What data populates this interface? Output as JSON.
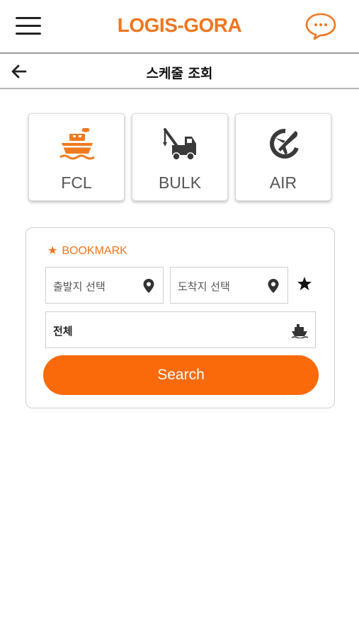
{
  "header": {
    "brand": "LOGIS-GORA",
    "menu_icon": "hamburger-menu-icon",
    "chat_icon": "chat-bubble-icon"
  },
  "subheader": {
    "title": "스케줄 조회",
    "back_icon": "arrow-left-icon"
  },
  "modes": [
    {
      "label": "FCL",
      "icon": "container-ship-icon"
    },
    {
      "label": "BULK",
      "icon": "crane-truck-icon"
    },
    {
      "label": "AIR",
      "icon": "airplane-icon"
    }
  ],
  "panel": {
    "bookmark_label": "BOOKMARK",
    "origin_placeholder": "출발지 선택",
    "destination_placeholder": "도착지 선택",
    "cargo_type_value": "전체",
    "search_label": "Search"
  },
  "colors": {
    "brand": "#f0761f",
    "search_button": "#fa6a0a",
    "icon_orange": "#f07a1e",
    "icon_dark": "#3a3a3a"
  }
}
